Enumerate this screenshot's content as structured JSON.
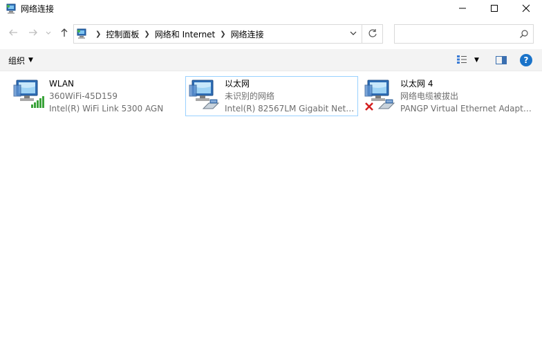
{
  "window": {
    "title": "网络连接",
    "minimize_icon": "minimize-icon",
    "maximize_icon": "maximize-icon",
    "close_icon": "close-icon"
  },
  "nav": {
    "breadcrumbs": [
      "控制面板",
      "网络和 Internet",
      "网络连接"
    ],
    "search_placeholder": "",
    "search_value": ""
  },
  "commandbar": {
    "organize_label": "组织",
    "help_label": "?"
  },
  "connections": [
    {
      "name": "WLAN",
      "status": "360WiFi-45D159",
      "adapter": "Intel(R) WiFi Link 5300 AGN",
      "type": "wifi",
      "selected": false
    },
    {
      "name": "以太网",
      "status": "未识别的网络",
      "adapter": "Intel(R) 82567LM Gigabit Netw…",
      "type": "ethernet",
      "selected": true
    },
    {
      "name": "以太网 4",
      "status": "网络电缆被拔出",
      "adapter": "PANGP Virtual Ethernet Adapt…",
      "type": "ethernet-disconnected",
      "selected": false
    }
  ],
  "colors": {
    "selection_border": "#99d1ff",
    "help_blue": "#1a73c9",
    "secondary_text": "#6d6d6d",
    "disconnected_red": "#d32020",
    "signal_green": "#3aa33a"
  }
}
